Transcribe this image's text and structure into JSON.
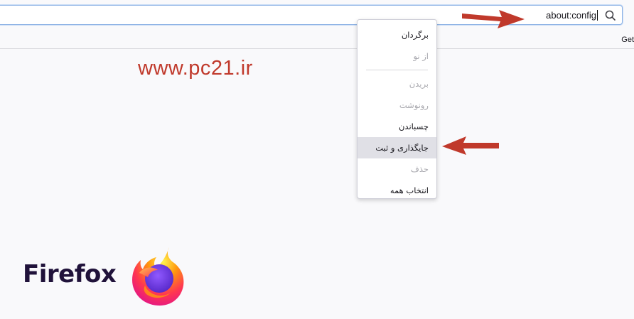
{
  "urlbar": {
    "value": "about:config",
    "search_icon": "search-icon"
  },
  "bookmarks": {
    "get_label": "Get"
  },
  "watermark": "www.pc21.ir",
  "context_menu": {
    "items": [
      {
        "label": "برگردان",
        "disabled": false
      },
      {
        "label": "از نو",
        "disabled": true
      },
      {
        "label": "بریدن",
        "disabled": true
      },
      {
        "label": "رونوشت",
        "disabled": true
      },
      {
        "label": "چسباندن",
        "disabled": false
      },
      {
        "label": "جایگذاری و ثبت",
        "disabled": false,
        "highlighted": true
      },
      {
        "label": "حذف",
        "disabled": true
      },
      {
        "label": "انتخاب همه",
        "disabled": false
      }
    ]
  },
  "branding": {
    "wordmark": "Firefox",
    "logo_icon": "firefox-logo-icon"
  },
  "annotation_color": "#c0392b"
}
